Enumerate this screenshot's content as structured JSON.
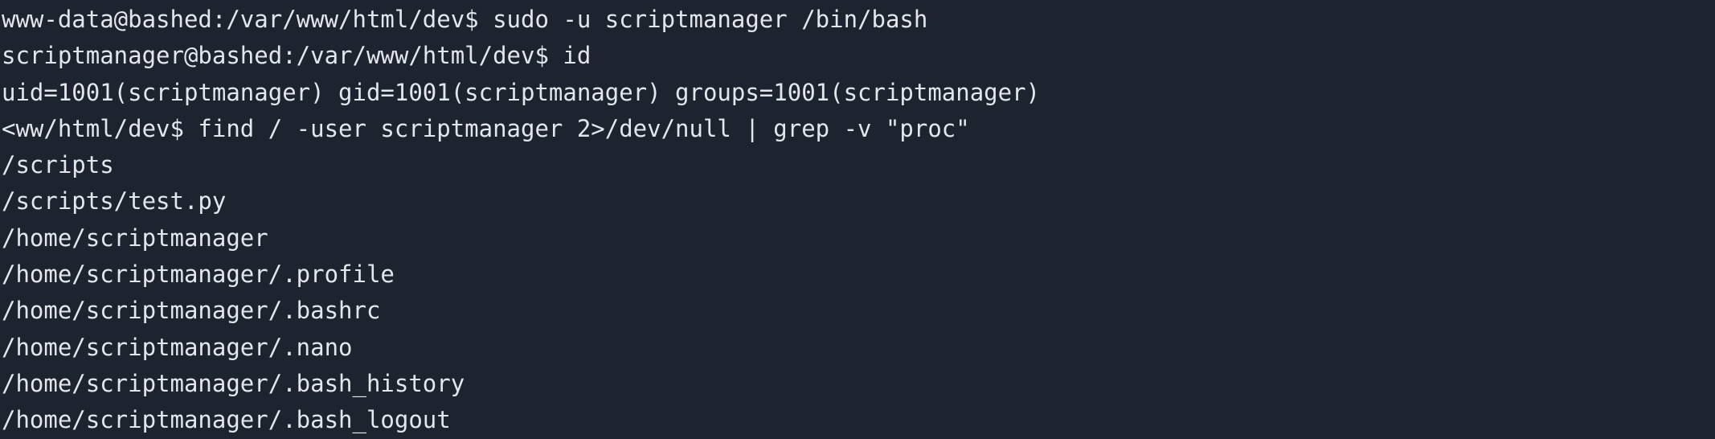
{
  "terminal": {
    "lines": [
      "www-data@bashed:/var/www/html/dev$ sudo -u scriptmanager /bin/bash",
      "scriptmanager@bashed:/var/www/html/dev$ id",
      "uid=1001(scriptmanager) gid=1001(scriptmanager) groups=1001(scriptmanager)",
      "<ww/html/dev$ find / -user scriptmanager 2>/dev/null | grep -v \"proc\"",
      "/scripts",
      "/scripts/test.py",
      "/home/scriptmanager",
      "/home/scriptmanager/.profile",
      "/home/scriptmanager/.bashrc",
      "/home/scriptmanager/.nano",
      "/home/scriptmanager/.bash_history",
      "/home/scriptmanager/.bash_logout"
    ]
  },
  "colors": {
    "background": "#1e2330",
    "foreground": "#e3e6ec"
  }
}
